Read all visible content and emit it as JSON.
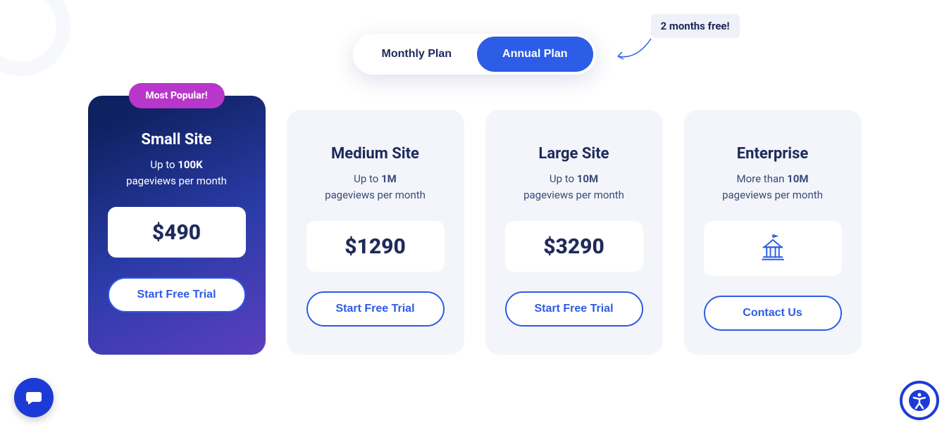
{
  "toggle": {
    "monthly": "Monthly Plan",
    "annual": "Annual Plan"
  },
  "promo": {
    "text": "2 months free!"
  },
  "plans": [
    {
      "badge": "Most Popular!",
      "name": "Small Site",
      "sub_prefix": "Up to ",
      "sub_bold": "100K",
      "sub_suffix": " pageviews per month",
      "price": "$490",
      "cta": "Start Free Trial"
    },
    {
      "name": "Medium Site",
      "sub_prefix": "Up to ",
      "sub_bold": "1M",
      "sub_suffix": " pageviews per month",
      "price": "$1290",
      "cta": "Start Free Trial"
    },
    {
      "name": "Large Site",
      "sub_prefix": "Up to ",
      "sub_bold": "10M",
      "sub_suffix": " pageviews per month",
      "price": "$3290",
      "cta": "Start Free Trial"
    },
    {
      "name": "Enterprise",
      "sub_prefix": "More than ",
      "sub_bold": "10M",
      "sub_suffix": " pageviews per month",
      "cta": "Contact Us"
    }
  ]
}
